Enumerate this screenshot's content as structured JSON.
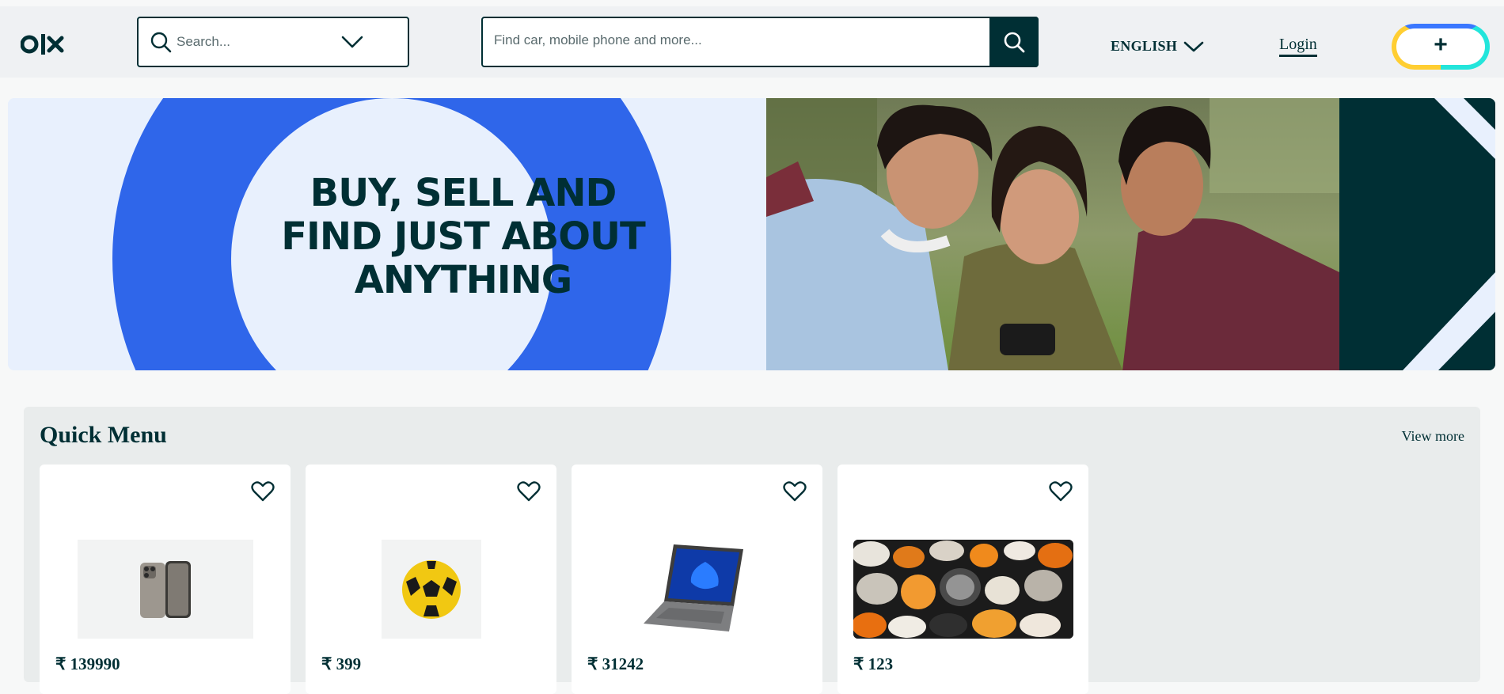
{
  "header": {
    "logo_text": "OLX",
    "location_search": {
      "placeholder": "Search..."
    },
    "main_search": {
      "placeholder": "Find car, mobile phone and more..."
    },
    "language": "ENGLISH",
    "login_label": "Login",
    "sell_label": "+"
  },
  "banner": {
    "headline_line1": "BUY, SELL AND",
    "headline_line2": "FIND JUST ABOUT",
    "headline_line3": "ANYTHING"
  },
  "quick_menu": {
    "title": "Quick Menu",
    "view_more_label": "View more",
    "items": [
      {
        "price": "₹ 139990",
        "image": "iphone"
      },
      {
        "price": "₹ 399",
        "image": "football"
      },
      {
        "price": "₹ 31242",
        "image": "laptop"
      },
      {
        "price": "₹ 123",
        "image": "pebbles"
      }
    ]
  },
  "colors": {
    "brand_dark": "#002f34",
    "banner_blue": "#2f66ea",
    "banner_bg": "#e8f0fd",
    "sell_yellow": "#ffce32",
    "sell_blue": "#3a77ff",
    "sell_cyan": "#23e5db"
  }
}
